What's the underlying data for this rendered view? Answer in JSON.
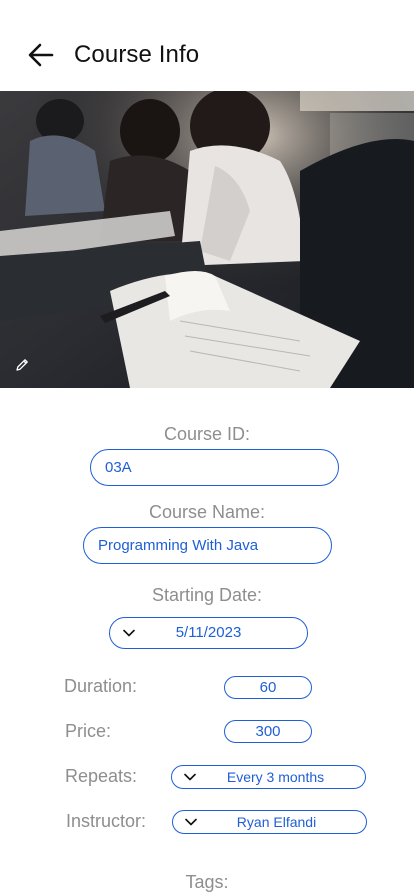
{
  "header": {
    "title": "Course Info"
  },
  "form": {
    "course_id": {
      "label": "Course ID:",
      "value": "03A"
    },
    "course_name": {
      "label": "Course Name:",
      "value": "Programming With Java"
    },
    "starting_date": {
      "label": "Starting Date:",
      "value": "5/11/2023"
    },
    "duration": {
      "label": "Duration:",
      "value": "60"
    },
    "price": {
      "label": "Price:",
      "value": "300"
    },
    "repeats": {
      "label": "Repeats:",
      "value": "Every 3 months"
    },
    "instructor": {
      "label": "Instructor:",
      "value": "Ryan Elfandi"
    },
    "tags": {
      "label": "Tags:"
    }
  },
  "icons": {
    "back": "arrow-left-icon",
    "edit": "pencil-icon",
    "dropdown": "chevron-down-icon"
  },
  "colors": {
    "accent": "#1f5fd6",
    "label": "#8e8e8e"
  }
}
